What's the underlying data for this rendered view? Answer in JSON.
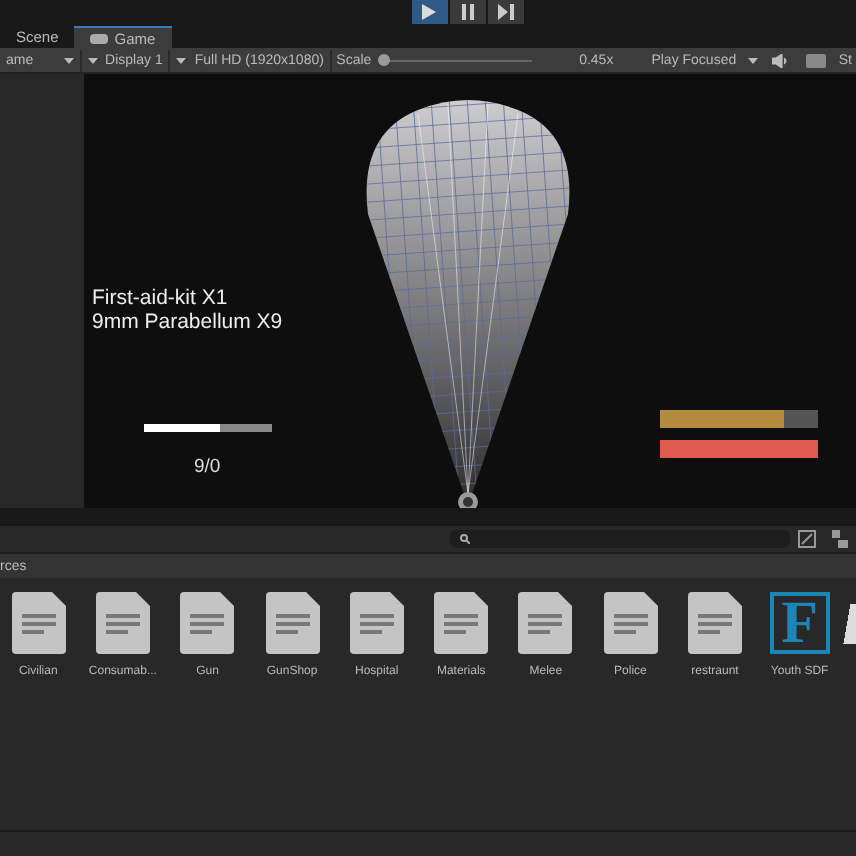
{
  "play_controls": {
    "playing": true,
    "paused": false
  },
  "tabs": [
    {
      "label": "Scene",
      "selected": false
    },
    {
      "label": "Game",
      "selected": true
    }
  ],
  "game_toolbar": {
    "view_dropdown": "ame",
    "display": "Display 1",
    "resolution": "Full HD (1920x1080)",
    "scale_label": "Scale",
    "scale": {
      "level": 0.0
    },
    "scale_value": "0.45x",
    "play_mode": "Play Focused",
    "stats_label": "St"
  },
  "hud": {
    "inventory": [
      "First-aid-kit X1",
      "9mm Parabellum X9"
    ],
    "health": {
      "level": 0.6
    },
    "ammo": "9/0",
    "bars": [
      {
        "level": 0.78,
        "color": "#b48a3c"
      },
      {
        "level": 1.0,
        "color": "#e05a50"
      }
    ]
  },
  "project": {
    "breadcrumb": "rces",
    "assets": [
      {
        "kind": "script",
        "label": "Civilian"
      },
      {
        "kind": "script",
        "label": "Consumab..."
      },
      {
        "kind": "script",
        "label": "Gun"
      },
      {
        "kind": "script",
        "label": "GunShop"
      },
      {
        "kind": "script",
        "label": "Hospital"
      },
      {
        "kind": "script",
        "label": "Materials"
      },
      {
        "kind": "script",
        "label": "Melee"
      },
      {
        "kind": "script",
        "label": "Police"
      },
      {
        "kind": "script",
        "label": "restraunt"
      },
      {
        "kind": "font",
        "label": "Youth SDF",
        "glyph": "F"
      },
      {
        "kind": "partial"
      }
    ]
  }
}
